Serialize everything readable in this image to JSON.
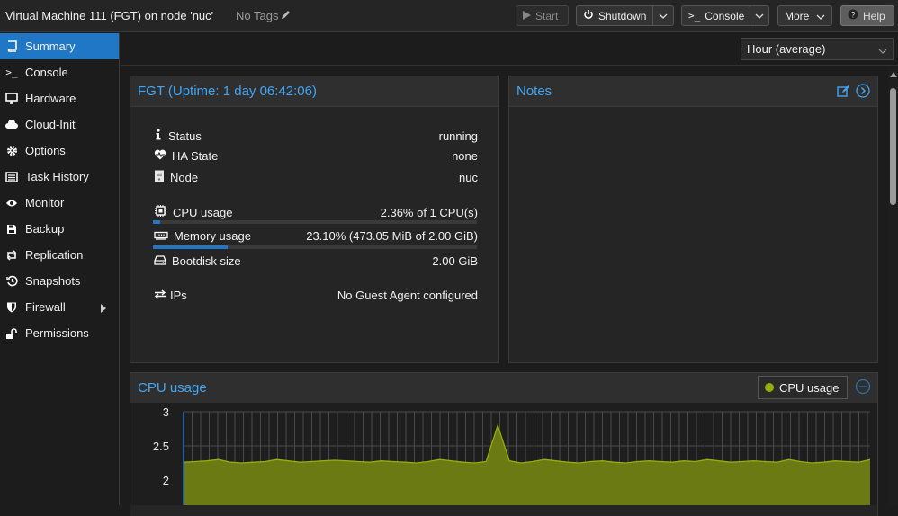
{
  "header": {
    "title": "Virtual Machine 111 (FGT) on node 'nuc'",
    "tags": "No Tags",
    "start": "Start",
    "shutdown": "Shutdown",
    "console": "Console",
    "more": "More",
    "help": "Help"
  },
  "sidebar": {
    "items": [
      {
        "label": "Summary",
        "icon": "book-icon"
      },
      {
        "label": "Console",
        "icon": "terminal-icon"
      },
      {
        "label": "Hardware",
        "icon": "monitor-icon"
      },
      {
        "label": "Cloud-Init",
        "icon": "cloud-icon"
      },
      {
        "label": "Options",
        "icon": "gear-icon"
      },
      {
        "label": "Task History",
        "icon": "list-icon"
      },
      {
        "label": "Monitor",
        "icon": "eye-icon"
      },
      {
        "label": "Backup",
        "icon": "floppy-icon"
      },
      {
        "label": "Replication",
        "icon": "retweet-icon"
      },
      {
        "label": "Snapshots",
        "icon": "history-icon"
      },
      {
        "label": "Firewall",
        "icon": "shield-icon"
      },
      {
        "label": "Permissions",
        "icon": "unlock-icon"
      }
    ]
  },
  "timeframe": "Hour (average)",
  "status_panel": {
    "title": "FGT (Uptime: 1 day 06:42:06)",
    "status_label": "Status",
    "status_value": "running",
    "ha_label": "HA State",
    "ha_value": "none",
    "node_label": "Node",
    "node_value": "nuc",
    "cpu_label": "CPU usage",
    "cpu_value": "2.36% of 1 CPU(s)",
    "cpu_fraction": 0.0236,
    "mem_label": "Memory usage",
    "mem_value": "23.10% (473.05 MiB of 2.00 GiB)",
    "mem_fraction": 0.231,
    "disk_label": "Bootdisk size",
    "disk_value": "2.00 GiB",
    "ips_label": "IPs",
    "ips_value": "No Guest Agent configured"
  },
  "notes_panel": {
    "title": "Notes"
  },
  "cpu_chart_panel": {
    "title": "CPU usage",
    "legend": "CPU usage"
  },
  "colors": {
    "accent": "#2077c5",
    "link": "#42a5f5",
    "series": "#94ae0a",
    "series_fill": "#6b7a12"
  },
  "chart_data": {
    "type": "area",
    "title": "CPU usage",
    "series": [
      {
        "name": "CPU usage",
        "values": [
          2.26,
          2.27,
          2.28,
          2.3,
          2.26,
          2.25,
          2.26,
          2.27,
          2.3,
          2.28,
          2.26,
          2.27,
          2.28,
          2.29,
          2.28,
          2.27,
          2.26,
          2.28,
          2.27,
          2.26,
          2.25,
          2.27,
          2.3,
          2.28,
          2.26,
          2.25,
          2.27,
          2.8,
          2.28,
          2.25,
          2.27,
          2.3,
          2.28,
          2.26,
          2.25,
          2.27,
          2.28,
          2.26,
          2.25,
          2.27,
          2.28,
          2.27,
          2.26,
          2.28,
          2.27,
          2.3,
          2.28,
          2.26,
          2.27,
          2.28,
          2.27,
          2.26,
          2.3,
          2.27,
          2.25,
          2.26,
          2.28,
          2.27,
          2.26,
          2.3
        ]
      }
    ],
    "yticks": [
      3,
      2.5,
      2
    ],
    "ylim": [
      1.75,
      3
    ]
  }
}
